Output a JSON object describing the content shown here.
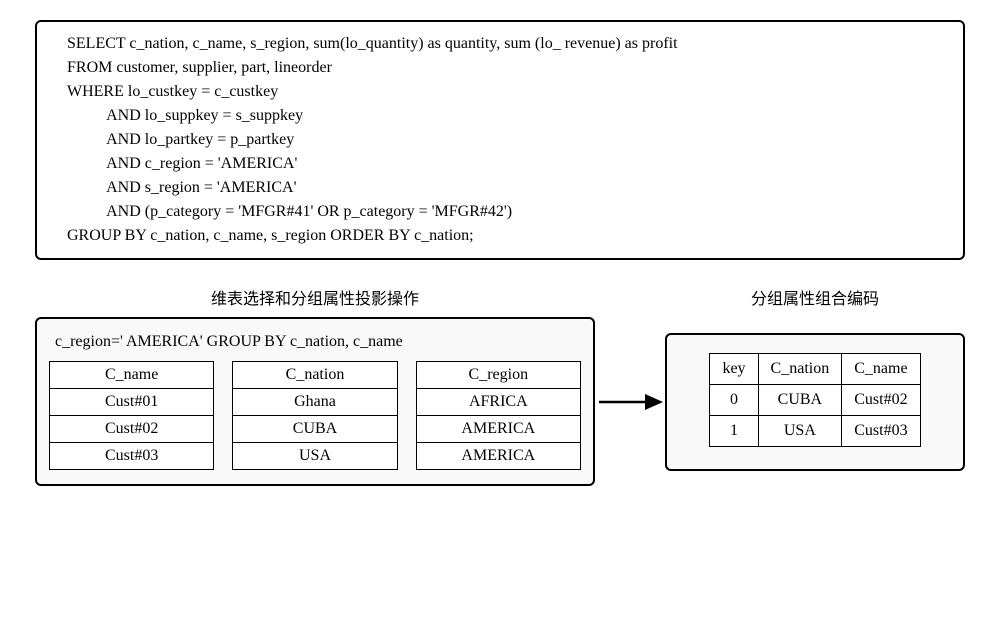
{
  "sql": {
    "lines": [
      "SELECT c_nation, c_name, s_region, sum(lo_quantity) as quantity, sum (lo_ revenue) as profit",
      "FROM customer, supplier, part, lineorder",
      "WHERE lo_custkey = c_custkey",
      "          AND lo_suppkey = s_suppkey",
      "          AND lo_partkey = p_partkey",
      "          AND c_region = 'AMERICA'",
      "          AND s_region = 'AMERICA'",
      "          AND (p_category = 'MFGR#41' OR p_category = 'MFGR#42')",
      "GROUP BY c_nation, c_name, s_region ORDER BY c_nation;"
    ]
  },
  "labels": {
    "left_title": "维表选择和分组属性投影操作",
    "right_title": "分组属性组合编码"
  },
  "left_panel": {
    "header": "c_region='  AMERICA'   GROUP BY c_nation, c_name",
    "table1": {
      "header": "C_name",
      "rows": [
        "Cust#01",
        "Cust#02",
        "Cust#03"
      ]
    },
    "table2": {
      "header": "C_nation",
      "rows": [
        "Ghana",
        "CUBA",
        "USA"
      ]
    },
    "table3": {
      "header": "C_region",
      "rows": [
        "AFRICA",
        "AMERICA",
        "AMERICA"
      ]
    }
  },
  "right_panel": {
    "headers": [
      "key",
      "C_nation",
      "C_name"
    ],
    "rows": [
      [
        "0",
        "CUBA",
        "Cust#02"
      ],
      [
        "1",
        "USA",
        "Cust#03"
      ]
    ]
  }
}
